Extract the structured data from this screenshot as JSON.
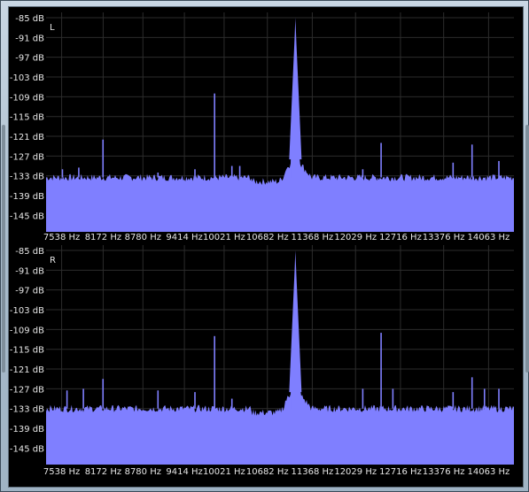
{
  "chart_data": [
    {
      "type": "area",
      "title": "",
      "channel": "L",
      "xlabel": "",
      "ylabel": "",
      "x_ticks": [
        "7538 Hz",
        "8172 Hz",
        "8780 Hz",
        "9414 Hz",
        "10021 Hz",
        "10682 Hz",
        "11368 Hz",
        "12029 Hz",
        "12716 Hz",
        "13376 Hz",
        "14063 Hz"
      ],
      "y_ticks": [
        "-85 dB",
        "-91 dB",
        "-97 dB",
        "-103 dB",
        "-109 dB",
        "-115 dB",
        "-121 dB",
        "-127 dB",
        "-133 dB",
        "-139 dB",
        "-145 dB"
      ],
      "xlim": [
        7300,
        14450
      ],
      "ylim": [
        -150,
        -85
      ],
      "fill_color": "#7f7fff",
      "grid": true,
      "noise_floor_db": -133.5,
      "peaks": [
        {
          "hz": 7550,
          "db": -131
        },
        {
          "hz": 7800,
          "db": -130.5
        },
        {
          "hz": 8170,
          "db": -122
        },
        {
          "hz": 9010,
          "db": -132
        },
        {
          "hz": 9575,
          "db": -131
        },
        {
          "hz": 9875,
          "db": -108
        },
        {
          "hz": 10140,
          "db": -130
        },
        {
          "hz": 10260,
          "db": -130
        },
        {
          "hz": 11050,
          "db": -128
        },
        {
          "hz": 11110,
          "db": -85
        },
        {
          "hz": 12140,
          "db": -131
        },
        {
          "hz": 12420,
          "db": -123
        },
        {
          "hz": 13520,
          "db": -129
        },
        {
          "hz": 13810,
          "db": -123.5
        },
        {
          "hz": 14220,
          "db": -128.5
        }
      ]
    },
    {
      "type": "area",
      "title": "",
      "channel": "R",
      "xlabel": "",
      "ylabel": "",
      "x_ticks": [
        "7538 Hz",
        "8172 Hz",
        "8780 Hz",
        "9414 Hz",
        "10021 Hz",
        "10682 Hz",
        "11368 Hz",
        "12029 Hz",
        "12716 Hz",
        "13376 Hz",
        "14063 Hz"
      ],
      "y_ticks": [
        "-85 dB",
        "-91 dB",
        "-97 dB",
        "-103 dB",
        "-109 dB",
        "-115 dB",
        "-121 dB",
        "-127 dB",
        "-133 dB",
        "-139 dB",
        "-145 dB"
      ],
      "xlim": [
        7300,
        14450
      ],
      "ylim": [
        -150,
        -85
      ],
      "fill_color": "#7f7fff",
      "grid": true,
      "noise_floor_db": -133,
      "peaks": [
        {
          "hz": 7620,
          "db": -127.5
        },
        {
          "hz": 7870,
          "db": -127
        },
        {
          "hz": 8170,
          "db": -124
        },
        {
          "hz": 9010,
          "db": -127.5
        },
        {
          "hz": 9575,
          "db": -128
        },
        {
          "hz": 9875,
          "db": -111
        },
        {
          "hz": 10140,
          "db": -130
        },
        {
          "hz": 11050,
          "db": -124
        },
        {
          "hz": 11110,
          "db": -85
        },
        {
          "hz": 12140,
          "db": -127
        },
        {
          "hz": 12420,
          "db": -110
        },
        {
          "hz": 12600,
          "db": -127
        },
        {
          "hz": 13520,
          "db": -128
        },
        {
          "hz": 13810,
          "db": -123.5
        },
        {
          "hz": 14000,
          "db": -127
        },
        {
          "hz": 14220,
          "db": -127
        }
      ]
    }
  ]
}
